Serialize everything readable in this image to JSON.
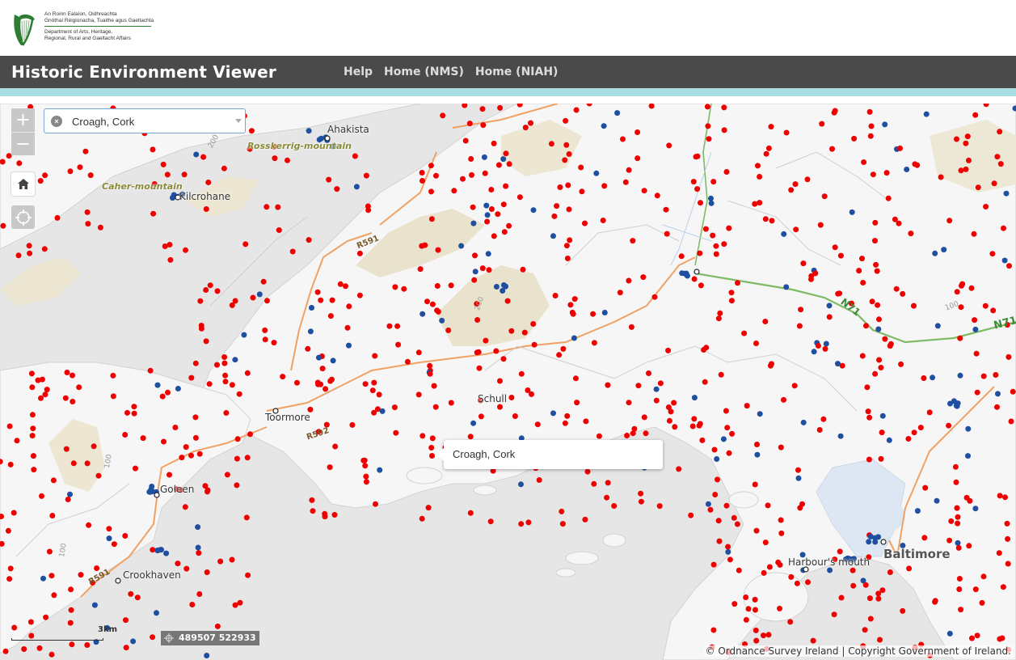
{
  "header": {
    "department_lines": [
      "An Roinn Ealaíon, Oidhreachta",
      "Gnóthaí Réigiúnacha, Tuaithe agus Gaeltachta",
      "Department of Arts, Heritage,",
      "Regional, Rural and Gaeltacht Affairs"
    ],
    "harp_icon": "harp-emblem-icon"
  },
  "titlebar": {
    "title": "Historic Environment Viewer",
    "nav": [
      "Help",
      "Home (NMS)",
      "Home (NIAH)"
    ]
  },
  "map": {
    "zoom_in": "+",
    "zoom_out": "−",
    "home_icon": "home-icon",
    "locate_icon": "locate-icon",
    "search_value": "Croagh, Cork",
    "popup_text": "Croagh, Cork",
    "scale_label": "3km",
    "coordinates": "489507 522933",
    "attribution": "© Ordnance Survey Ireland | Copyright Government of Ireland.",
    "places": [
      {
        "name": "Ahakista"
      },
      {
        "name": "Rosskerrig-mountain"
      },
      {
        "name": "Caher-mountain"
      },
      {
        "name": "Kilcrohane"
      },
      {
        "name": "Schull"
      },
      {
        "name": "Toormore"
      },
      {
        "name": "Goleen"
      },
      {
        "name": "Crookhaven"
      },
      {
        "name": "Harbour's mouth"
      },
      {
        "name": "Baltimore"
      }
    ],
    "roads": [
      "R591",
      "R592",
      "N71",
      "N71",
      "R591"
    ],
    "contours": [
      "200",
      "200",
      "100",
      "100",
      "100"
    ],
    "colors": {
      "monument_site": "#ee0000",
      "niah_site": "#1f4fa0",
      "land": "#f7f7f7",
      "sea": "#e6e6e6",
      "upland": "#e8e2cc",
      "road_regional": "#f0a264",
      "road_national": "#7dbb65"
    }
  }
}
